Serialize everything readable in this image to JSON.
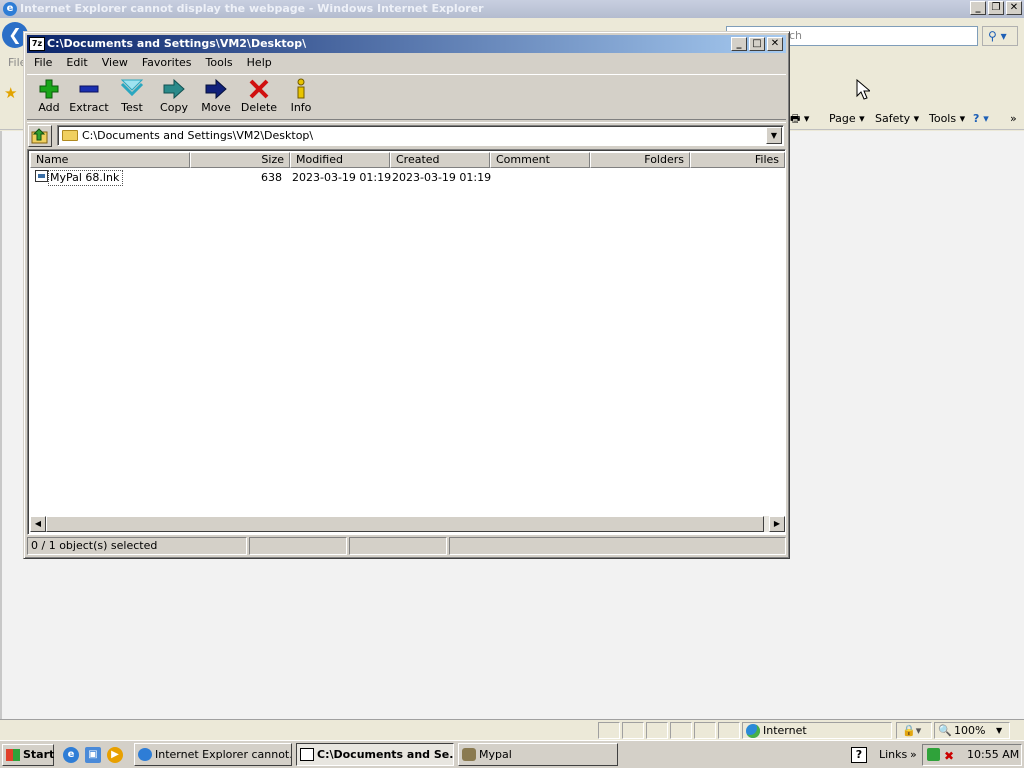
{
  "ie": {
    "title": "Internet Explorer cannot display the webpage - Windows Internet Explorer",
    "search_placeholder": "ch",
    "menu_stub": "File",
    "commands": {
      "page": "Page",
      "safety": "Safety",
      "tools": "Tools"
    },
    "status": {
      "zone": "Internet",
      "zoom": "100%"
    }
  },
  "sevenzip": {
    "title": "C:\\Documents and Settings\\VM2\\Desktop\\",
    "menu": [
      "File",
      "Edit",
      "View",
      "Favorites",
      "Tools",
      "Help"
    ],
    "toolbar": [
      {
        "label": "Add",
        "icon": "add-icon",
        "color": "#1aa51a"
      },
      {
        "label": "Extract",
        "icon": "extract-icon",
        "color": "#1a2fb0"
      },
      {
        "label": "Test",
        "icon": "test-icon",
        "color": "#2aa7c0"
      },
      {
        "label": "Copy",
        "icon": "copy-icon",
        "color": "#2a8a8a"
      },
      {
        "label": "Move",
        "icon": "move-icon",
        "color": "#10207a"
      },
      {
        "label": "Delete",
        "icon": "delete-icon",
        "color": "#d01010"
      },
      {
        "label": "Info",
        "icon": "info-icon",
        "color": "#d0b000"
      }
    ],
    "path": "C:\\Documents and Settings\\VM2\\Desktop\\",
    "columns": [
      "Name",
      "Size",
      "Modified",
      "Created",
      "Comment",
      "Folders",
      "Files"
    ],
    "rows": [
      {
        "name": "MyPal 68.lnk",
        "size": "638",
        "modified": "2023-03-19 01:19",
        "created": "2023-03-19 01:19"
      }
    ],
    "status": "0 / 1 object(s) selected"
  },
  "taskbar": {
    "start": "Start",
    "tasks": [
      "Internet Explorer cannot...",
      "C:\\Documents and Se...",
      "Mypal"
    ],
    "links": "Links",
    "clock": "10:55 AM"
  }
}
